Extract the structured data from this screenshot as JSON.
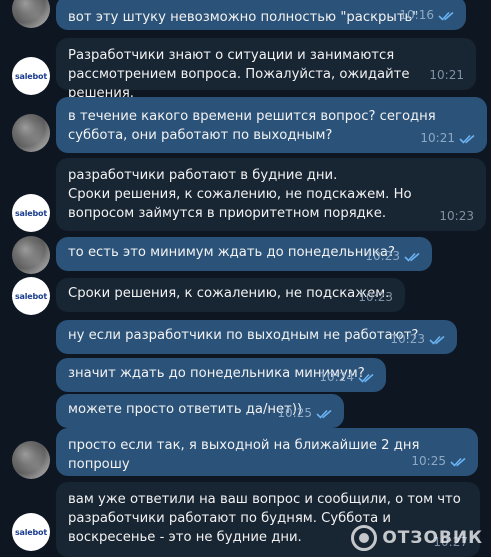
{
  "colors": {
    "background": "#0e1621",
    "outgoing": "#2b5278",
    "incoming": "#182533",
    "check": "#6ab2f2"
  },
  "bot_avatar_label": "salebot",
  "messages": [
    {
      "dir": "out",
      "avatar": true,
      "text": "вот эту штуку невозможно полностью \"раскрыть\"",
      "time": "10:16",
      "read": true
    },
    {
      "dir": "in",
      "avatar": true,
      "text": "Разработчики знают о ситуации и занимаются рассмотрением вопроса. Пожалуйста, ожидайте решения.",
      "time": "10:21"
    },
    {
      "dir": "out",
      "avatar": true,
      "text": "в течение какого времени решится вопрос? сегодня суббота, они работают по выходным?",
      "time": "10:21",
      "read": true
    },
    {
      "dir": "in",
      "avatar": true,
      "text": "разработчики работают в будние дни.\nСроки решения, к сожалению, не подскажем. Но вопросом займутся в приоритетном порядке.",
      "time": "10:23"
    },
    {
      "dir": "out",
      "avatar": true,
      "text": "то есть это минимум ждать до понедельника?",
      "time": "10:23",
      "read": true
    },
    {
      "dir": "in",
      "avatar": true,
      "text": "Сроки решения, к сожалению, не подскажем.",
      "time": "10:23"
    },
    {
      "dir": "out",
      "avatar": false,
      "text": "ну если разработчики по выходным не работают?",
      "time": "10:23",
      "read": true
    },
    {
      "dir": "out",
      "avatar": false,
      "text": "значит ждать до понедельника минимум?",
      "time": "10:24",
      "read": true
    },
    {
      "dir": "out",
      "avatar": true,
      "text": "можете просто ответить да/нет))",
      "time": "10:25",
      "read": true
    },
    {
      "dir": "out",
      "avatar": true,
      "text": "просто если так, я выходной на ближайшие 2 дня попрошу",
      "time": "10:25",
      "read": true
    },
    {
      "dir": "in",
      "avatar": true,
      "text": "вам уже ответили на ваш вопрос и сообщили, о том что разработчики работают по будням. Суббота и воскресенье - это не будние дни.",
      "time": "10:27"
    }
  ],
  "watermark": "ОТЗОВИК"
}
